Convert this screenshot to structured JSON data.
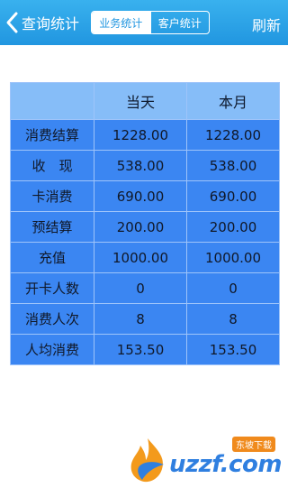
{
  "nav": {
    "back_label": "查询统计",
    "tabs": [
      {
        "label": "业务统计",
        "active": true
      },
      {
        "label": "客户统计",
        "active": false
      }
    ],
    "refresh_label": "刷新"
  },
  "table": {
    "columns": [
      "",
      "当天",
      "本月"
    ],
    "rows": [
      {
        "label": "消费结算",
        "today": "1228.00",
        "month": "1228.00"
      },
      {
        "label": "收　现",
        "today": "538.00",
        "month": "538.00"
      },
      {
        "label": "卡消费",
        "today": "690.00",
        "month": "690.00"
      },
      {
        "label": "预结算",
        "today": "200.00",
        "month": "200.00"
      },
      {
        "label": "充值",
        "today": "1000.00",
        "month": "1000.00"
      },
      {
        "label": "开卡人数",
        "today": "0",
        "month": "0"
      },
      {
        "label": "消费人次",
        "today": "8",
        "month": "8"
      },
      {
        "label": "人均消费",
        "today": "153.50",
        "month": "153.50"
      }
    ]
  },
  "watermark": {
    "text": "uzzf.com",
    "badge": "东坡下载"
  },
  "colors": {
    "nav": "#2196e0",
    "table_cell": "#3b86f2",
    "table_header": "#86bdf8"
  }
}
